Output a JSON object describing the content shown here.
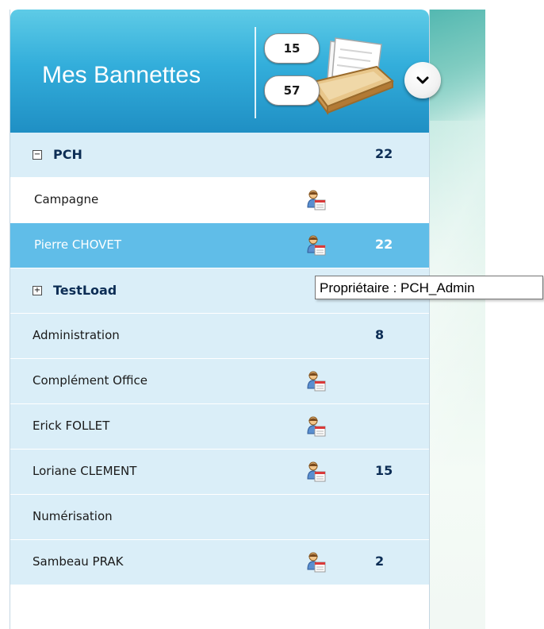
{
  "header": {
    "title": "Mes Bannettes",
    "counter_top": "15",
    "counter_bottom": "57"
  },
  "rows": [
    {
      "label": "PCH",
      "count": "22",
      "toggle": "−"
    },
    {
      "label": "Campagne"
    },
    {
      "label": "Pierre CHOVET",
      "count": "22"
    },
    {
      "label": "TestLoad",
      "toggle": "+"
    },
    {
      "label": "Administration",
      "count": "8"
    },
    {
      "label": "Complément Office"
    },
    {
      "label": "Erick FOLLET"
    },
    {
      "label": "Loriane CLEMENT",
      "count": "15"
    },
    {
      "label": "Numérisation"
    },
    {
      "label": "Sambeau PRAK",
      "count": "2"
    }
  ],
  "tooltip": {
    "text": "Propriétaire : PCH_Admin"
  },
  "icons": {
    "tray": "tray-icon",
    "chevron": "chevron-down-icon",
    "owner": "owner-icon"
  },
  "colors": {
    "header_top": "#5ecbe6",
    "header_bottom": "#1f8fc4",
    "row_light": "#daeef8",
    "row_selected": "#60bde8",
    "count_text": "#0c2d55"
  }
}
